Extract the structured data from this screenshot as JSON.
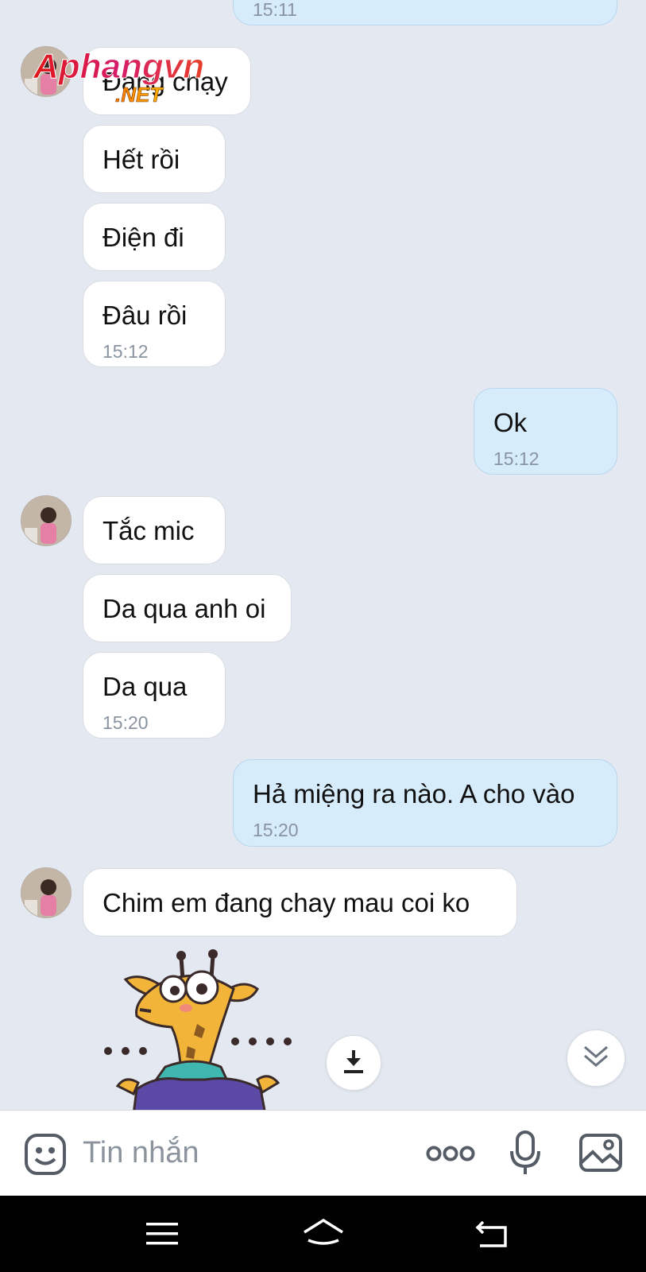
{
  "messages": [
    {
      "side": "out",
      "time": "15:11"
    },
    {
      "side": "in",
      "text": "Đang chạy"
    },
    {
      "side": "in",
      "text": "Hết rồi"
    },
    {
      "side": "in",
      "text": "Điện đi"
    },
    {
      "side": "in",
      "text": "Đâu rồi",
      "time": "15:12"
    },
    {
      "side": "out",
      "text": "Ok",
      "time": "15:12"
    },
    {
      "side": "in",
      "text": "Tắc mic"
    },
    {
      "side": "in",
      "text": "Da qua anh oi"
    },
    {
      "side": "in",
      "text": "Da qua",
      "time": "15:20"
    },
    {
      "side": "out",
      "text": "Hả miệng ra nào. A cho vào",
      "time": "15:20"
    },
    {
      "side": "in",
      "text": "Chim em đang chay mau coi ko"
    }
  ],
  "watermark": {
    "text": "Aphangvn",
    "sub": ".NET"
  },
  "input": {
    "placeholder": "Tin nhắn"
  },
  "icons": {
    "emoji": "emoji-icon",
    "more": "more-dots-icon",
    "mic": "microphone-icon",
    "image": "image-icon",
    "download": "download-icon",
    "scroll_down": "double-chevron-down-icon",
    "nav_menu": "menu-icon",
    "nav_home": "home-icon",
    "nav_back": "back-icon"
  },
  "colors": {
    "background": "#e3e8f1",
    "incoming_bubble": "#ffffff",
    "outgoing_bubble": "#d6ecfb",
    "timestamp": "#8a94a0"
  }
}
